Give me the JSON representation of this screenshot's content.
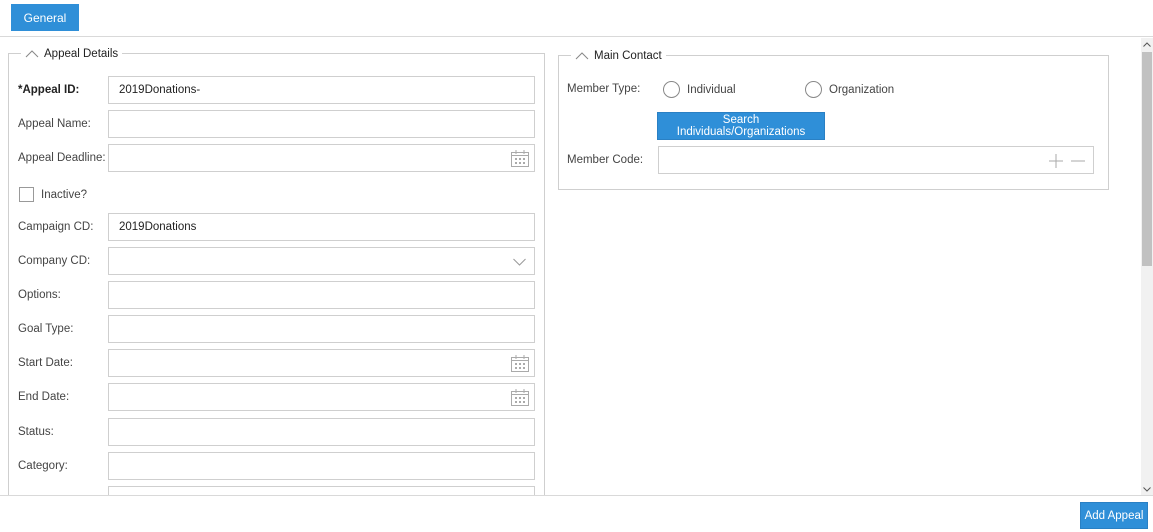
{
  "tabs": {
    "general_label": "General"
  },
  "appeal_details": {
    "legend": "Appeal Details",
    "appeal_id": {
      "label": "*Appeal ID:",
      "value": "2019Donations-"
    },
    "appeal_name": {
      "label": "Appeal Name:",
      "value": ""
    },
    "appeal_deadline": {
      "label": "Appeal Deadline:",
      "value": ""
    },
    "inactive": {
      "label": "Inactive?",
      "checked": false
    },
    "campaign_cd": {
      "label": "Campaign CD:",
      "value": "2019Donations"
    },
    "company_cd": {
      "label": "Company CD:",
      "value": ""
    },
    "options": {
      "label": "Options:",
      "value": ""
    },
    "goal_type": {
      "label": "Goal Type:",
      "value": ""
    },
    "start_date": {
      "label": "Start Date:",
      "value": ""
    },
    "end_date": {
      "label": "End Date:",
      "value": ""
    },
    "status": {
      "label": "Status:",
      "value": ""
    },
    "category": {
      "label": "Category:",
      "value": ""
    }
  },
  "main_contact": {
    "legend": "Main Contact",
    "member_type": {
      "label": "Member Type:",
      "options": [
        "Individual",
        "Organization"
      ],
      "selected": null
    },
    "search_button": "Search Individuals/Organizations",
    "member_code": {
      "label": "Member Code:",
      "value": ""
    }
  },
  "footer": {
    "add_button": "Add Appeal"
  },
  "icons": {
    "calendar": "calendar-icon",
    "dropdown": "chevron-down-icon",
    "collapse": "chevron-up-icon",
    "add": "plus-icon",
    "remove": "minus-icon"
  },
  "colors": {
    "accent": "#2f8fd8",
    "border": "#cfcfcf"
  }
}
